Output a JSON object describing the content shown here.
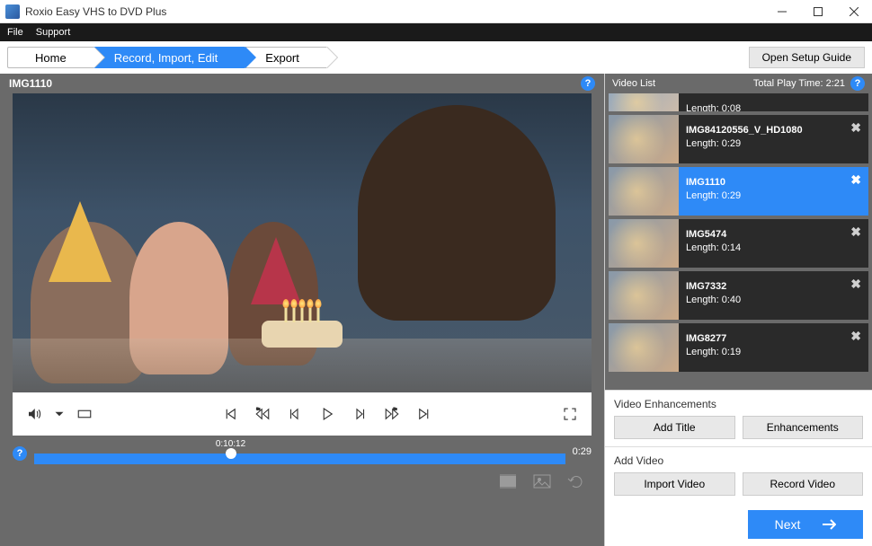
{
  "titlebar": {
    "app_title": "Roxio Easy VHS to DVD Plus"
  },
  "menubar": {
    "file": "File",
    "support": "Support"
  },
  "nav": {
    "home": "Home",
    "record": "Record, Import, Edit",
    "export": "Export",
    "setup": "Open Setup Guide"
  },
  "preview": {
    "clip_name": "IMG1110",
    "help": "?"
  },
  "timeline": {
    "position": "0:10:12",
    "duration": "0:29"
  },
  "side": {
    "list_label": "Video List",
    "total_label": "Total Play Time:",
    "total_time": "2:21",
    "help": "?"
  },
  "videos": [
    {
      "name": "",
      "length_label": "Length:",
      "length": "0:08",
      "partial": true
    },
    {
      "name": "IMG84120556_V_HD1080",
      "length_label": "Length:",
      "length": "0:29"
    },
    {
      "name": "IMG1110",
      "length_label": "Length:",
      "length": "0:29",
      "selected": true
    },
    {
      "name": "IMG5474",
      "length_label": "Length:",
      "length": "0:14"
    },
    {
      "name": "IMG7332",
      "length_label": "Length:",
      "length": "0:40"
    },
    {
      "name": "IMG8277",
      "length_label": "Length:",
      "length": "0:19"
    }
  ],
  "enh": {
    "section": "Video Enhancements",
    "add_title": "Add Title",
    "enhancements": "Enhancements"
  },
  "addv": {
    "section": "Add Video",
    "import": "Import Video",
    "record": "Record Video"
  },
  "next": {
    "label": "Next"
  },
  "close_glyph": "✖"
}
